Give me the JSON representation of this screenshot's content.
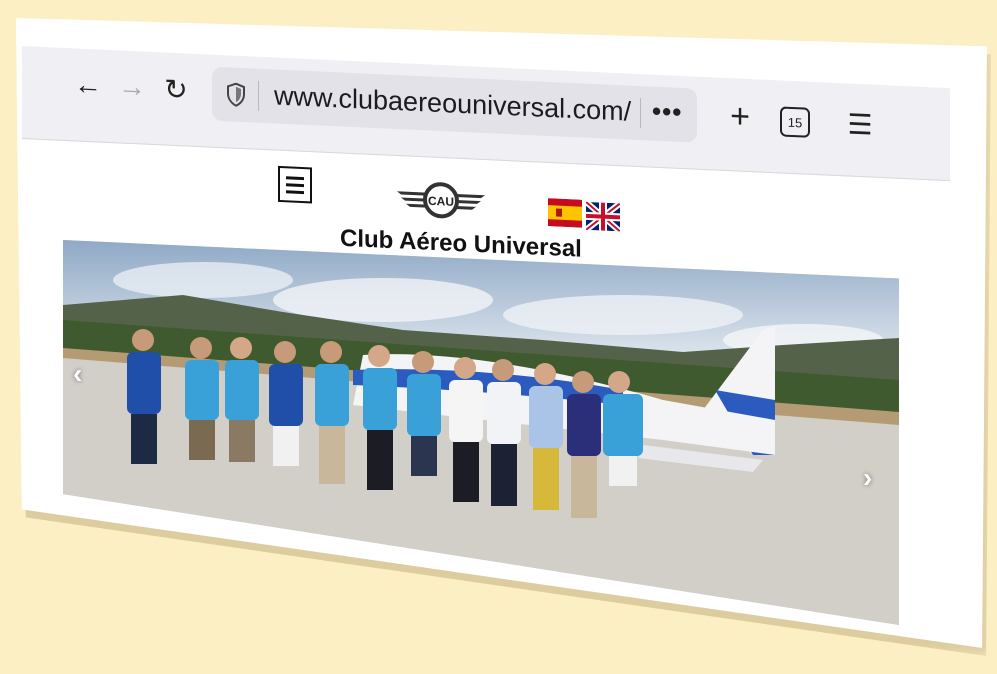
{
  "browser": {
    "back_icon": "←",
    "forward_icon": "→",
    "reload_icon": "↻",
    "url": "www.clubaereouniversal.com/",
    "more_label": "•••",
    "new_tab_icon": "+",
    "tab_count": "15",
    "menu_icon": "☰"
  },
  "site": {
    "logo_text": "CAU",
    "title": "Club Aéreo Universal",
    "languages": [
      "es",
      "en"
    ]
  },
  "carousel": {
    "prev_label": "‹",
    "next_label": "›"
  },
  "colors": {
    "background": "#fcefc4",
    "toolbar": "#f0f0f4",
    "urlbar": "#e2e2e8",
    "shirt_blue": "#3aa0d8",
    "plane_blue": "#2b5bbf"
  }
}
